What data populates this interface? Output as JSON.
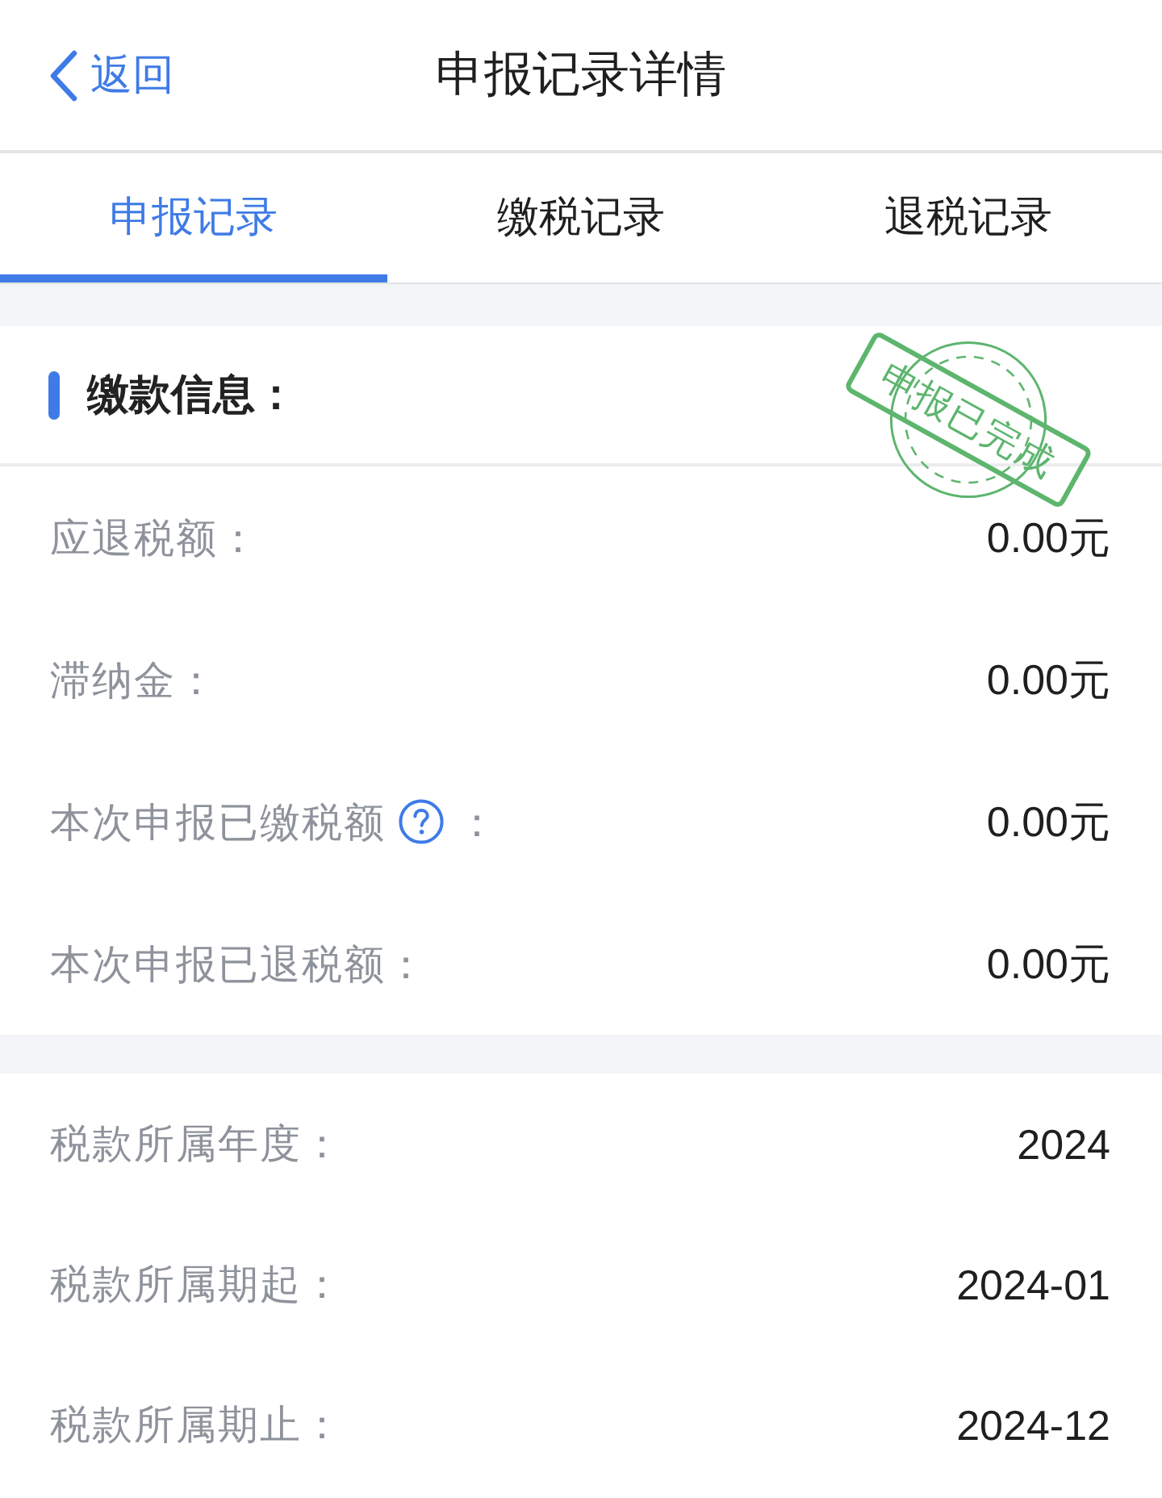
{
  "nav": {
    "back_label": "返回",
    "title": "申报记录详情"
  },
  "tabs": [
    {
      "label": "申报记录",
      "selected": true
    },
    {
      "label": "缴税记录",
      "selected": false
    },
    {
      "label": "退税记录",
      "selected": false
    }
  ],
  "sections": [
    {
      "title": "缴款信息：",
      "stamp": {
        "text": "申报已完成"
      },
      "rows": [
        {
          "label": "应退税额：",
          "value": "0.00元",
          "help": false
        },
        {
          "label": "滞纳金：",
          "value": "0.00元",
          "help": false
        },
        {
          "label": "本次申报已缴税额",
          "help": true,
          "label_suffix": "：",
          "value": "0.00元"
        },
        {
          "label": "本次申报已退税额：",
          "value": "0.00元",
          "help": false
        }
      ]
    },
    {
      "rows": [
        {
          "label": "税款所属年度：",
          "value": "2024",
          "help": false
        },
        {
          "label": "税款所属期起：",
          "value": "2024-01",
          "help": false
        },
        {
          "label": "税款所属期止：",
          "value": "2024-12",
          "help": false
        }
      ]
    }
  ]
}
